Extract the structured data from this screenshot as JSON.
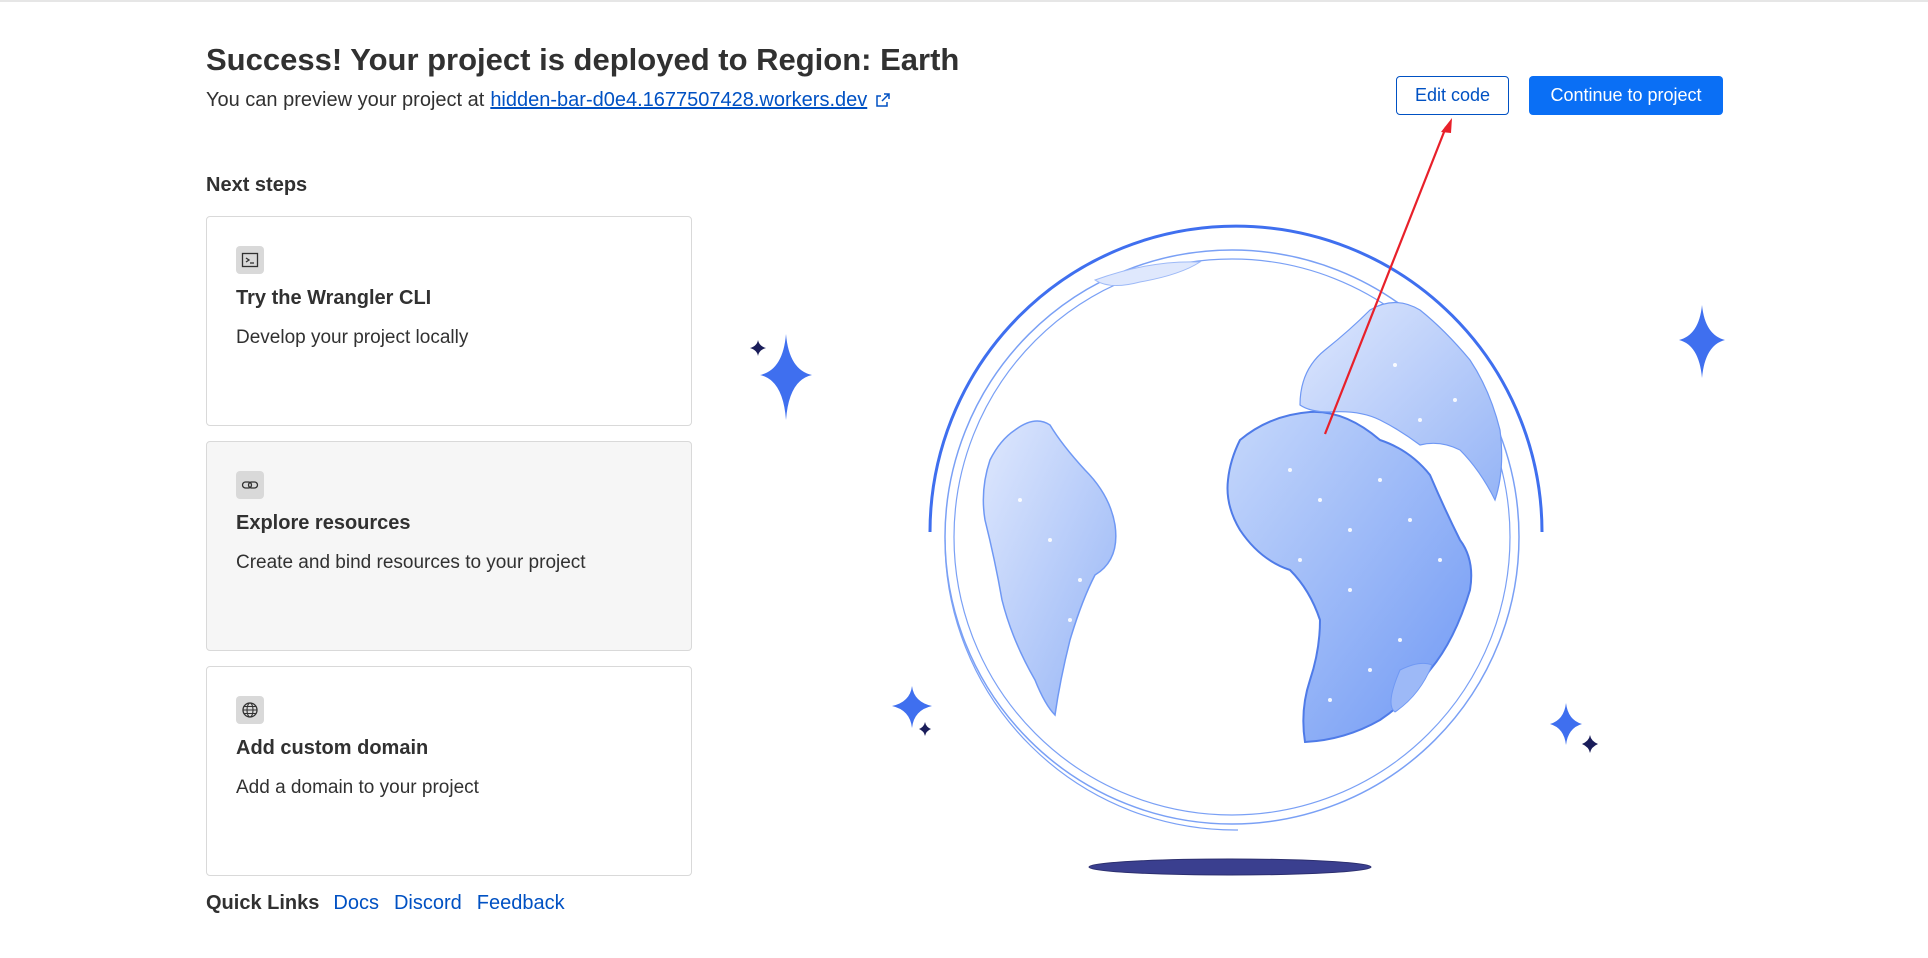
{
  "header": {
    "title": "Success! Your project is deployed to Region: Earth",
    "preview_prefix": "You can preview your project at",
    "preview_link": "hidden-bar-d0e4.1677507428.workers.dev",
    "external_icon": "external-link-icon"
  },
  "actions": {
    "edit_code": "Edit code",
    "continue": "Continue to project"
  },
  "next_steps": {
    "title": "Next steps",
    "cards": [
      {
        "icon": "terminal-icon",
        "title": "Try the Wrangler CLI",
        "description": "Develop your project locally"
      },
      {
        "icon": "link-icon",
        "title": "Explore resources",
        "description": "Create and bind resources to your project"
      },
      {
        "icon": "globe-icon",
        "title": "Add custom domain",
        "description": "Add a domain to your project"
      }
    ]
  },
  "quick_links": {
    "label": "Quick Links",
    "links": [
      "Docs",
      "Discord",
      "Feedback"
    ]
  },
  "colors": {
    "primary": "#0a6ff5",
    "link": "#0051c3",
    "globe": "#7ea3f7",
    "annotation_arrow": "#e8202a"
  }
}
